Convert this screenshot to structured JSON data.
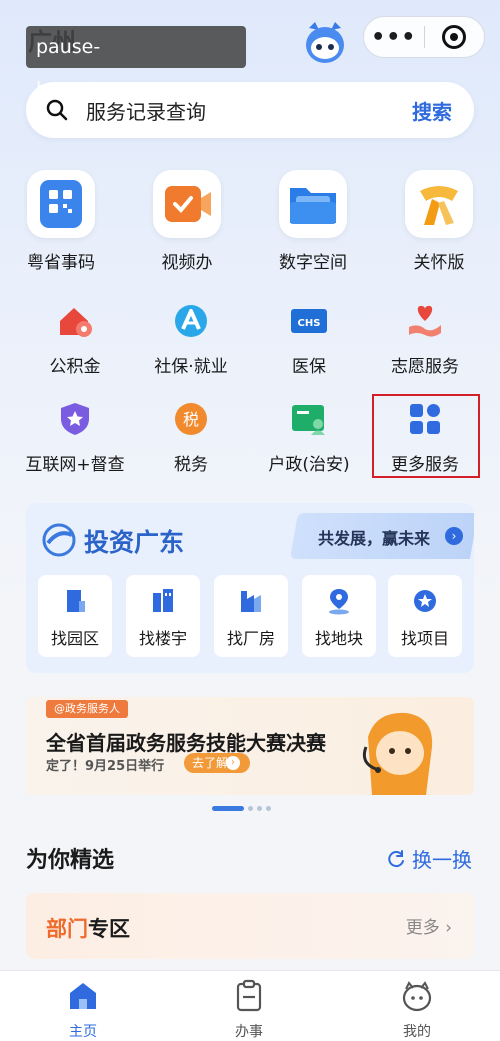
{
  "header": {
    "city": "广州",
    "watermark": "pause-bsports.com.cn",
    "capsule_more": "•••"
  },
  "search": {
    "placeholder": "服务记录查询",
    "button": "搜索"
  },
  "top_services": [
    {
      "label": "粤省事码",
      "icon": "qr-code-icon"
    },
    {
      "label": "视频办",
      "icon": "video-icon"
    },
    {
      "label": "数字空间",
      "icon": "folder-icon"
    },
    {
      "label": "关怀版",
      "icon": "scarf-icon"
    }
  ],
  "services_row2": [
    {
      "label": "公积金",
      "icon": "house-fund-icon"
    },
    {
      "label": "社保·就业",
      "icon": "social-security-icon"
    },
    {
      "label": "医保",
      "icon": "medical-insurance-icon"
    },
    {
      "label": "志愿服务",
      "icon": "volunteer-heart-icon"
    }
  ],
  "services_row3": [
    {
      "label": "互联网+督查",
      "icon": "star-shield-icon"
    },
    {
      "label": "税务",
      "icon": "tax-icon"
    },
    {
      "label": "户政(治安)",
      "icon": "id-card-icon"
    },
    {
      "label": "更多服务",
      "icon": "grid-icon"
    }
  ],
  "invest": {
    "title": "投资广东",
    "slogan": "共发展，赢未来",
    "items": [
      "找园区",
      "找楼宇",
      "找厂房",
      "找地块",
      "找项目"
    ]
  },
  "banner": {
    "tag": "@政务服务人",
    "title": "全省首届政务服务技能大赛决赛",
    "subtitle": "定了！9月25日举行",
    "button": "去了解"
  },
  "picks": {
    "title": "为你精选",
    "refresh": "换一换"
  },
  "dept": {
    "title_highlight": "部门",
    "title_rest": "专区",
    "more": "更多 ›"
  },
  "tabbar": [
    {
      "label": "主页",
      "icon": "home-icon",
      "active": true
    },
    {
      "label": "办事",
      "icon": "clipboard-icon",
      "active": false
    },
    {
      "label": "我的",
      "icon": "profile-icon",
      "active": false
    }
  ],
  "colors": {
    "accent": "#2f6bde",
    "highlight_border": "#d21f2a",
    "dept_accent": "#ee6b2c"
  }
}
